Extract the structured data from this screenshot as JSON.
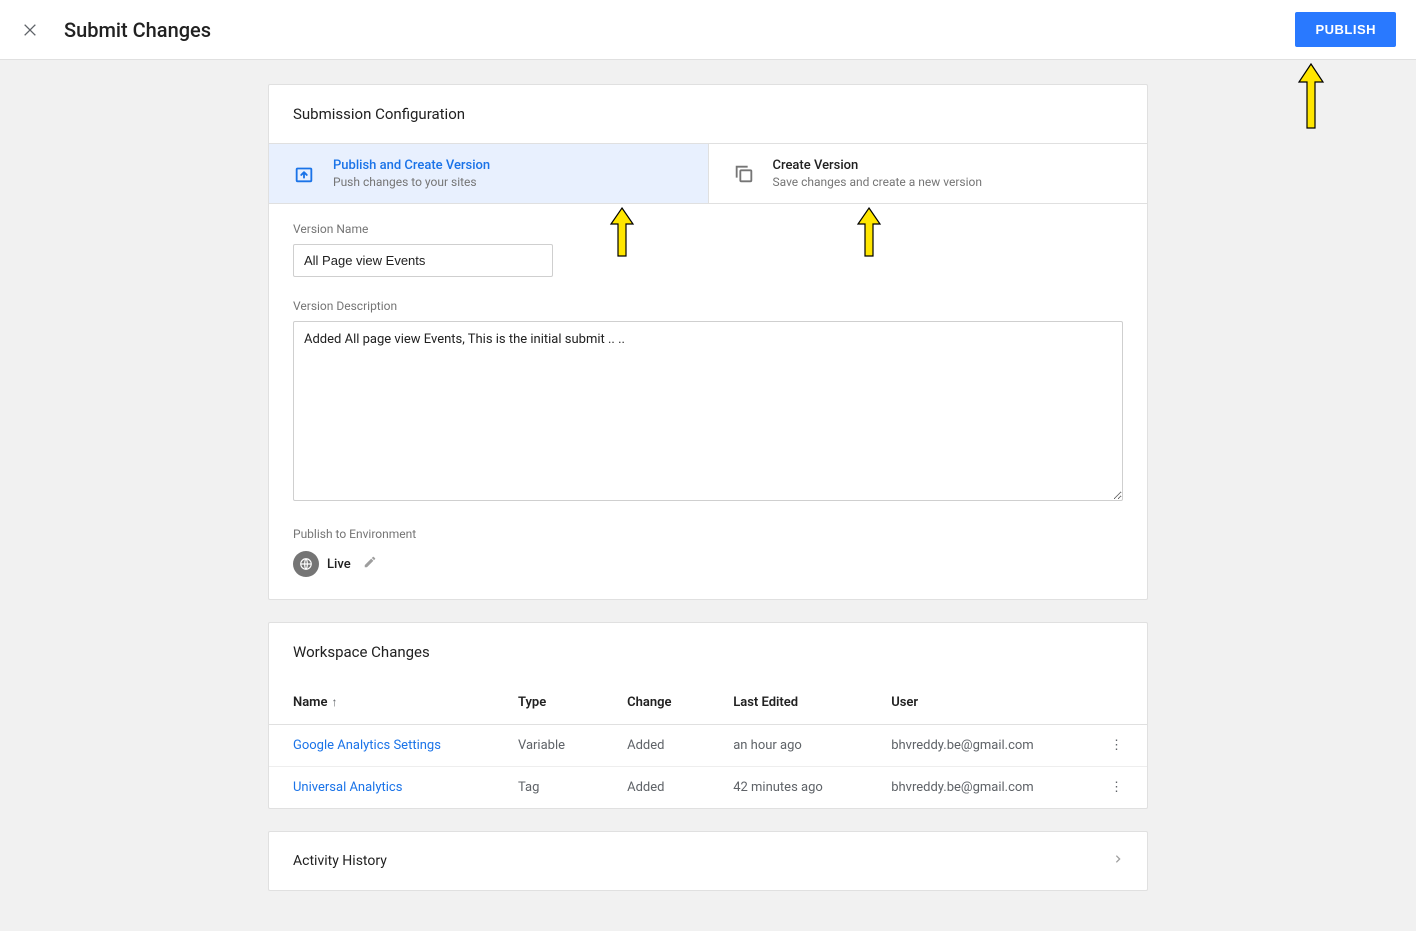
{
  "header": {
    "title": "Submit Changes",
    "publish_label": "PUBLISH"
  },
  "config": {
    "section_title": "Submission Configuration",
    "options": {
      "publish": {
        "title": "Publish and Create Version",
        "subtitle": "Push changes to your sites"
      },
      "create": {
        "title": "Create Version",
        "subtitle": "Save changes and create a new version"
      }
    },
    "version_name_label": "Version Name",
    "version_name_value": "All Page view Events",
    "version_desc_label": "Version Description",
    "version_desc_value": "Added All page view Events, This is the initial submit .. ..",
    "env_label": "Publish to Environment",
    "env_name": "Live"
  },
  "workspace": {
    "section_title": "Workspace Changes",
    "columns": {
      "name": "Name",
      "type": "Type",
      "change": "Change",
      "last_edited": "Last Edited",
      "user": "User"
    },
    "rows": [
      {
        "name": "Google Analytics Settings",
        "type": "Variable",
        "change": "Added",
        "last_edited": "an hour ago",
        "user": "bhvreddy.be@gmail.com"
      },
      {
        "name": "Universal Analytics",
        "type": "Tag",
        "change": "Added",
        "last_edited": "42 minutes ago",
        "user": "bhvreddy.be@gmail.com"
      }
    ]
  },
  "activity": {
    "title": "Activity History"
  }
}
